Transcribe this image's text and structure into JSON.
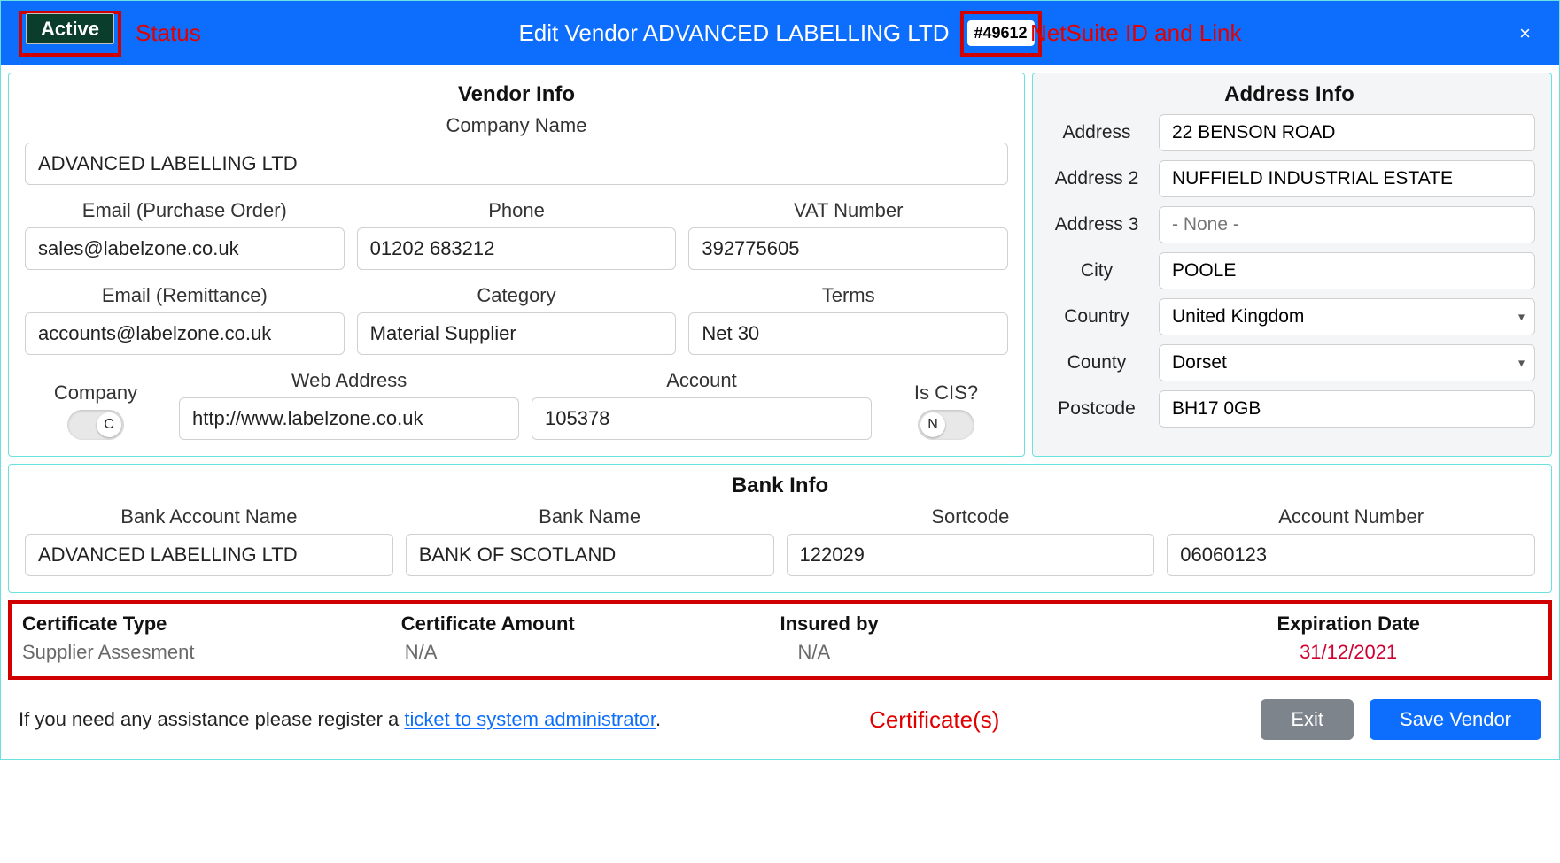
{
  "header": {
    "status_label": "Active",
    "title": "Edit Vendor ADVANCED LABELLING LTD",
    "id_link": "#49612",
    "close": "×"
  },
  "annotations": {
    "status": "Status",
    "netsuite": "NetSuite ID and Link",
    "certificates": "Certificate(s)"
  },
  "vendor_info": {
    "title": "Vendor Info",
    "company_name_label": "Company Name",
    "company_name": "ADVANCED LABELLING LTD",
    "email_po_label": "Email (Purchase Order)",
    "email_po": "sales@labelzone.co.uk",
    "phone_label": "Phone",
    "phone": "01202 683212",
    "vat_label": "VAT Number",
    "vat": "392775605",
    "email_remit_label": "Email (Remittance)",
    "email_remit": "accounts@labelzone.co.uk",
    "category_label": "Category",
    "category": "Material Supplier",
    "terms_label": "Terms",
    "terms": "Net 30",
    "company_toggle_label": "Company",
    "company_toggle": "C",
    "web_label": "Web Address",
    "web": "http://www.labelzone.co.uk",
    "account_label": "Account",
    "account": "105378",
    "cis_label": "Is CIS?",
    "cis_toggle": "N"
  },
  "address_info": {
    "title": "Address Info",
    "address_label": "Address",
    "address": "22 BENSON ROAD",
    "address2_label": "Address 2",
    "address2": "NUFFIELD INDUSTRIAL ESTATE",
    "address3_label": "Address 3",
    "address3": "- None -",
    "city_label": "City",
    "city": "POOLE",
    "country_label": "Country",
    "country": "United Kingdom",
    "county_label": "County",
    "county": "Dorset",
    "postcode_label": "Postcode",
    "postcode": "BH17 0GB"
  },
  "bank_info": {
    "title": "Bank Info",
    "account_name_label": "Bank Account Name",
    "account_name": "ADVANCED LABELLING LTD",
    "bank_name_label": "Bank Name",
    "bank_name": "BANK OF SCOTLAND",
    "sortcode_label": "Sortcode",
    "sortcode": "122029",
    "account_number_label": "Account Number",
    "account_number": "06060123"
  },
  "certificates": {
    "headers": {
      "type": "Certificate Type",
      "amount": "Certificate Amount",
      "insured": "Insured by",
      "expiration": "Expiration Date"
    },
    "row": {
      "type": "Supplier Assesment",
      "amount": "N/A",
      "insured": "N/A",
      "expiration": "31/12/2021"
    }
  },
  "footer": {
    "assist_prefix": "If you need any assistance please register a ",
    "assist_link": "ticket to system administrator",
    "assist_suffix": ".",
    "exit": "Exit",
    "save": "Save Vendor"
  }
}
